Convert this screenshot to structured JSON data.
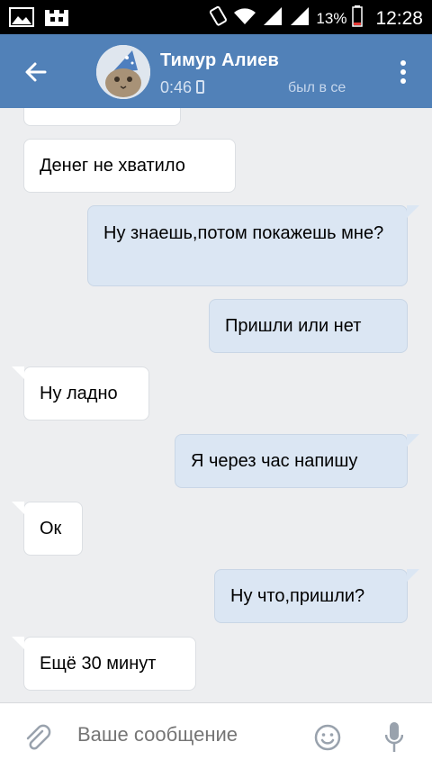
{
  "status_bar": {
    "battery": "13%",
    "time": "12:28"
  },
  "header": {
    "name": "Тимур Алиев",
    "time": "0:46",
    "status": "был в се"
  },
  "messages": [
    {
      "dir": "in",
      "text": ""
    },
    {
      "dir": "in",
      "text": "Денег не хватило"
    },
    {
      "dir": "out",
      "text": "Ну знаешь,потом покажешь мне?"
    },
    {
      "dir": "out",
      "text": "Пришли или нет"
    },
    {
      "dir": "in",
      "text": "Ну ладно"
    },
    {
      "dir": "out",
      "text": "Я через час напишу"
    },
    {
      "dir": "in",
      "text": "Ок"
    },
    {
      "dir": "out",
      "text": "Ну что,пришли?"
    },
    {
      "dir": "in",
      "text": "Ещё 30 минут"
    }
  ],
  "input": {
    "placeholder": "Ваше сообщение"
  },
  "colors": {
    "header": "#5181b8",
    "incoming": "#ffffff",
    "outgoing": "#dbe6f3",
    "background": "#edeef0"
  }
}
